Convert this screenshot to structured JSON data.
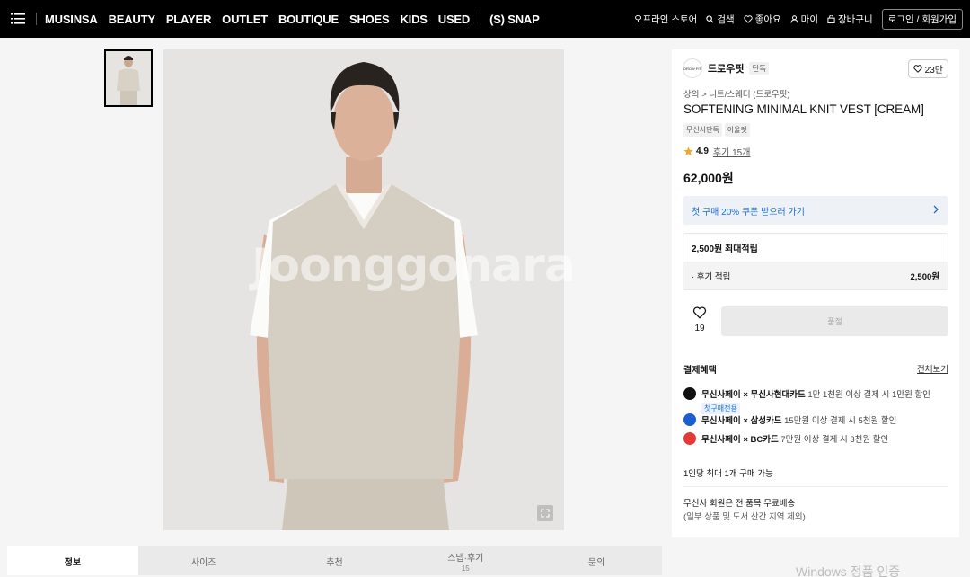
{
  "nav": {
    "menu_icon": "hamburger-menu-icon",
    "links": [
      "MUSINSA",
      "BEAUTY",
      "PLAYER",
      "OUTLET",
      "BOUTIQUE",
      "SHOES",
      "KIDS",
      "USED"
    ],
    "snap": "(S) SNAP",
    "right": {
      "offline_store": "오프라인 스토어",
      "search": "검색",
      "likes": "좋아요",
      "my": "마이",
      "cart": "장바구니",
      "login": "로그인 / 회원가입"
    }
  },
  "gallery": {
    "watermark": "Joonggonara"
  },
  "product": {
    "brand_logo_text": "DROW FIT",
    "brand": "드로우핏",
    "brand_tag": "단독",
    "likes": "23만",
    "breadcrumb": "상의 > 니트/스웨터 (드로우핏)",
    "title": "SOFTENING MINIMAL KNIT VEST [CREAM]",
    "tags": [
      "무신사단독",
      "아울렛"
    ],
    "rating": "4.9",
    "reviews_link": "후기 15개",
    "price": "62,000원",
    "coupon": "첫 구매 20% 쿠폰 받으러 가기",
    "points_title": "2,500원 최대적립",
    "points_row_label": "· 후기 적립",
    "points_row_value": "2,500원",
    "wish_count": "19",
    "soldout_label": "품절",
    "payment_title": "결제혜택",
    "payment_all": "전체보기",
    "payments": [
      {
        "name": "무신사페이 × 무신사현대카드",
        "desc": "1만 1천원 이상 결제 시 1만원 할인",
        "badge": "첫구매전용",
        "color": "#111111"
      },
      {
        "name": "무신사페이 × 삼성카드",
        "desc": "15만원 이상 결제 시 5천원 할인",
        "badge": "",
        "color": "#1a5fd1"
      },
      {
        "name": "무신사페이 × BC카드",
        "desc": "7만원 이상 결제 시 3천원 할인",
        "badge": "",
        "color": "#e53935"
      }
    ],
    "purchase_limit": "1인당 최대 1개 구매 가능",
    "shipping_title": "무신사 회원은 전 품목 무료배송",
    "shipping_note": "(일부 상품 및 도서 산간 지역 제외)"
  },
  "tabs": [
    {
      "label": "정보",
      "count": ""
    },
    {
      "label": "사이즈",
      "count": ""
    },
    {
      "label": "추천",
      "count": ""
    },
    {
      "label": "스냅·후기",
      "count": "15"
    },
    {
      "label": "문의",
      "count": ""
    }
  ],
  "os_watermark": "Windows 정품 인증"
}
